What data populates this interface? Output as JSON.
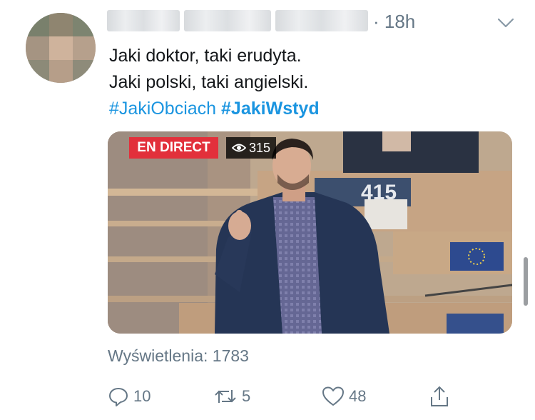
{
  "tweet": {
    "timestamp": "· 18h",
    "lines": [
      "Jaki doktor, taki erudyta.",
      "Jaki polski, taki angielski."
    ],
    "hashtags": [
      "#JakiObciach",
      "#JakiWstyd"
    ]
  },
  "media": {
    "live_badge": "EN DIRECT",
    "view_count": "315",
    "seat_number": "415"
  },
  "views": "Wyświetlenia: 1783",
  "actions": {
    "reply_count": "10",
    "retweet_count": "5",
    "like_count": "48"
  },
  "icons": [
    "chevron-down-icon",
    "eye-icon",
    "reply-icon",
    "retweet-icon",
    "like-icon",
    "share-icon"
  ],
  "colors": {
    "link": "#1b95e0",
    "secondary_text": "#657786",
    "live_badge": "#e2303b"
  }
}
